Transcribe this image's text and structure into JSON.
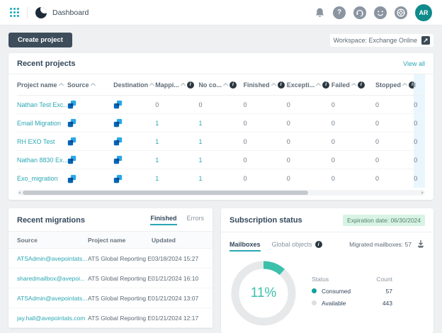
{
  "header": {
    "page_title": "Dashboard",
    "avatar_initials": "AR",
    "icons": [
      "app-launcher",
      "fly-logo",
      "bell",
      "help",
      "headset",
      "feedback",
      "support-ring",
      "avatar"
    ]
  },
  "toolbar": {
    "create_project_label": "Create project",
    "workspace_label": "Workspace: Exchange Online"
  },
  "recent_projects": {
    "title": "Recent projects",
    "view_all_label": "View all",
    "columns": [
      {
        "label": "Project name",
        "sort": true,
        "info": false
      },
      {
        "label": "Source",
        "sort": true,
        "info": false
      },
      {
        "label": "Destination",
        "sort": true,
        "info": false
      },
      {
        "label": "Mappi...",
        "sort": true,
        "info": true
      },
      {
        "label": "No co...",
        "sort": true,
        "info": true
      },
      {
        "label": "Finished",
        "sort": true,
        "info": true
      },
      {
        "label": "Excepti...",
        "sort": true,
        "info": true
      },
      {
        "label": "Failed",
        "sort": true,
        "info": true
      },
      {
        "label": "Stopped",
        "sort": true,
        "info": true
      },
      {
        "label": "I",
        "sort": false,
        "info": false,
        "highlight": true
      }
    ],
    "rows": [
      {
        "name": "Nathan Test Exc...",
        "mappings": "0",
        "no_content": "0",
        "finished": "0",
        "exceptions": "0",
        "failed": "0",
        "stopped": "0",
        "last": "0"
      },
      {
        "name": "Email Migration",
        "mappings": "1",
        "no_content": "1",
        "finished": "0",
        "exceptions": "0",
        "failed": "0",
        "stopped": "0",
        "last": "0"
      },
      {
        "name": "RH EXO Test",
        "mappings": "1",
        "no_content": "1",
        "finished": "0",
        "exceptions": "0",
        "failed": "0",
        "stopped": "0",
        "last": "0"
      },
      {
        "name": "Nathan 8830 Ex...",
        "mappings": "1",
        "no_content": "1",
        "finished": "0",
        "exceptions": "0",
        "failed": "0",
        "stopped": "0",
        "last": "0"
      },
      {
        "name": "Exo_migration",
        "mappings": "1",
        "no_content": "1",
        "finished": "0",
        "exceptions": "0",
        "failed": "0",
        "stopped": "0",
        "last": "0"
      }
    ]
  },
  "recent_migrations": {
    "title": "Recent migrations",
    "tabs": [
      "Finished",
      "Errors"
    ],
    "active_tab": "Finished",
    "columns": [
      "Source",
      "Project name",
      "Updated"
    ],
    "rows": [
      {
        "source": "ATSAdmin@avepointats...",
        "project": "ATS Global Reporting EXO",
        "updated": "03/18/2024 15:27"
      },
      {
        "source": "sharedmailbox@avepoi...",
        "project": "ATS Global Reporting EXO",
        "updated": "01/21/2024 16:10"
      },
      {
        "source": "ATSAdmin@avepointats...",
        "project": "ATS Global Reporting EXO",
        "updated": "01/21/2024 13:07"
      },
      {
        "source": "jay.hall@avepointats.com",
        "project": "ATS Global Reporting EXO",
        "updated": "01/21/2024 12:17"
      }
    ]
  },
  "subscription": {
    "title": "Subscription status",
    "expiration_badge": "Expiration date: 06/30/2024",
    "tabs": [
      "Mailboxes",
      "Global objects"
    ],
    "active_tab": "Mailboxes",
    "migrated_label": "Migrated mailboxes: 57",
    "chart_data": {
      "type": "pie",
      "title": "Subscription status - Mailboxes",
      "labels": [
        "Consumed",
        "Available"
      ],
      "values": [
        57,
        443
      ],
      "center_label": "11%",
      "legend_headers": [
        "Status",
        "Count"
      ],
      "legend_position": "right",
      "colors": [
        "#3bc0ab",
        "#e6e8ea"
      ],
      "dot_colors": [
        "#16a09e",
        "#dcdfe2"
      ]
    }
  },
  "colors": {
    "accent_teal": "#2ba7b4",
    "donut_teal": "#3bc0ab",
    "button_dark": "#3e4d5c",
    "avatar_bg": "#0f8b8b",
    "badge_bg": "#d8f3e4",
    "highlight_column_bg": "#e9f6fd",
    "page_bg": "#eef0f1"
  }
}
